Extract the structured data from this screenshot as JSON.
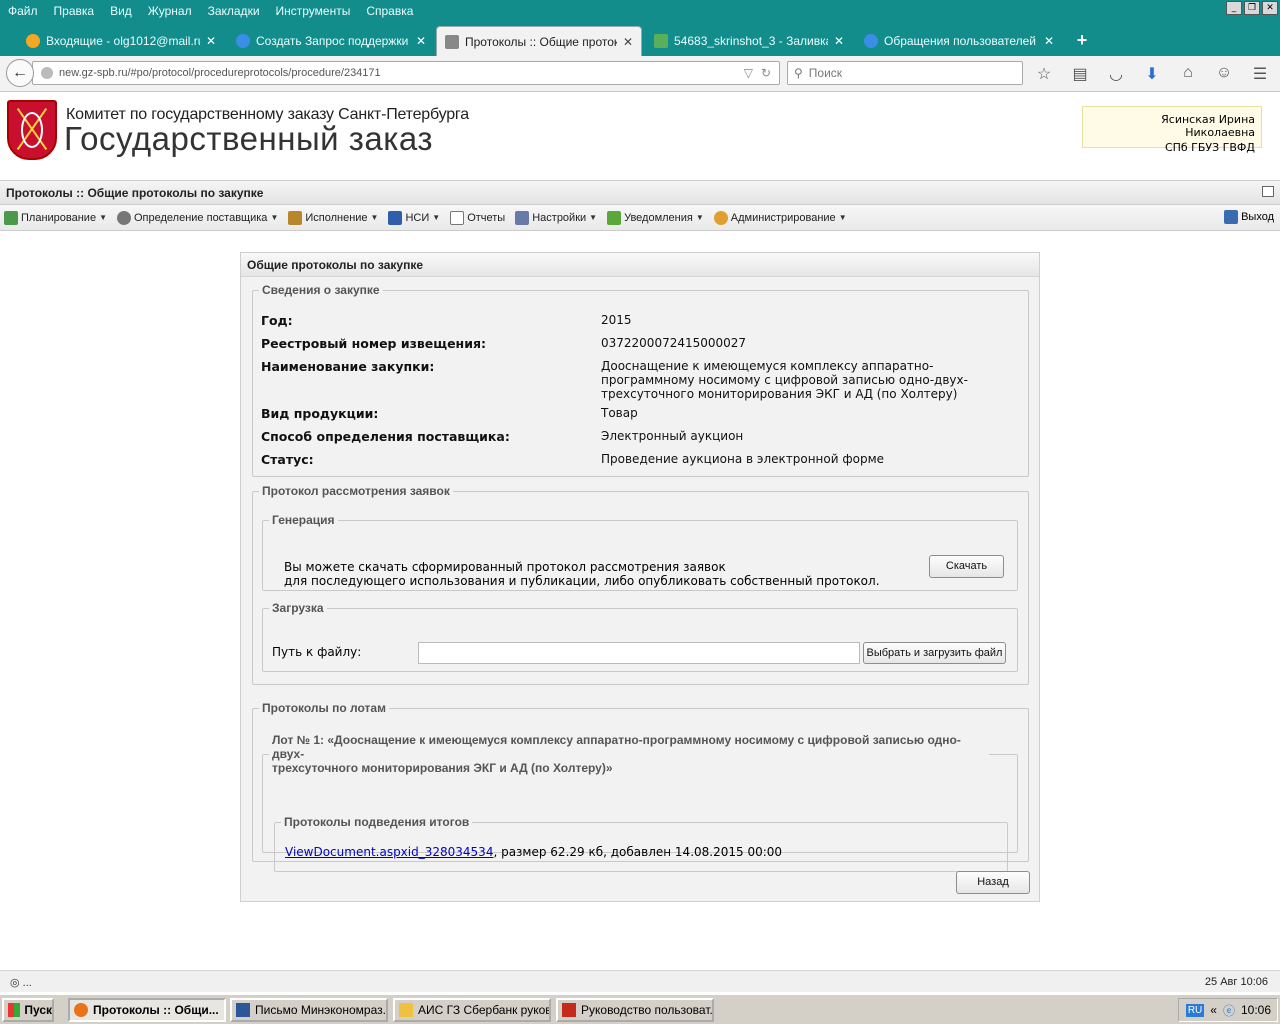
{
  "browser": {
    "menu": [
      "Файл",
      "Правка",
      "Вид",
      "Журнал",
      "Закладки",
      "Инструменты",
      "Справка"
    ],
    "tabs": [
      {
        "title": "Входящие - olg1012@mail.ru -..."
      },
      {
        "title": "Создать Запрос поддержки ..."
      },
      {
        "title": "Протоколы :: Общие проток..."
      },
      {
        "title": "54683_skrinshot_3 - Заливка ..."
      },
      {
        "title": "Обращения пользователей ..."
      }
    ],
    "url": "new.gz-spb.ru/#po/protocol/procedureprotocols/procedure/234171",
    "search_placeholder": "Поиск"
  },
  "header": {
    "org": "Комитет по государственному заказу Санкт-Петербурга",
    "title": "Государственный заказ",
    "user_name": "Ясинская Ирина Николаевна",
    "user_org": "СПб ГБУЗ ГВФД"
  },
  "page_title": "Протоколы :: Общие протоколы по закупке",
  "toolbar": {
    "items": [
      "Планирование",
      "Определение поставщика",
      "Исполнение",
      "НСИ",
      "Отчеты",
      "Настройки",
      "Уведомления",
      "Администрирование"
    ],
    "exit": "Выход"
  },
  "panel": {
    "title": "Общие протоколы по закупке",
    "info": {
      "legend": "Сведения о закупке",
      "rows": [
        {
          "label": "Год:",
          "value": "2015"
        },
        {
          "label": "Реестровый номер извещения:",
          "value": "0372200072415000027"
        },
        {
          "label": "Наименование закупки:",
          "value": "Дооснащение к имеющемуся комплексу аппаратно-программному носимому с цифровой записью одно-двух-трехсуточного мониторирования ЭКГ и АД (по Холтеру)"
        },
        {
          "label": "Вид продукции:",
          "value": "Товар"
        },
        {
          "label": "Способ определения поставщика:",
          "value": "Электронный аукцион"
        },
        {
          "label": "Статус:",
          "value": "Проведение аукциона в электронной форме"
        }
      ]
    },
    "review": {
      "legend": "Протокол рассмотрения заявок",
      "generation": {
        "legend": "Генерация",
        "text1": "Вы можете скачать сформированный протокол рассмотрения заявок",
        "text2": "для последующего использования и публикации, либо опубликовать собственный протокол.",
        "download": "Скачать"
      },
      "upload": {
        "legend": "Загрузка",
        "label": "Путь к файлу:",
        "value": "",
        "button": "Выбрать и загрузить файл"
      }
    },
    "lots": {
      "legend": "Протоколы по лотам",
      "lot_legend_1": "Лот № 1: «Дооснащение к имеющемуся комплексу аппаратно-программному носимому с цифровой записью одно-двух-",
      "lot_legend_2": "трехсуточного мониторирования ЭКГ и АД (по Холтеру)»",
      "results_legend": "Протоколы подведения итогов",
      "doc_link": "ViewDocument.aspxid_328034534",
      "doc_meta": ", размер 62.29 кб, добавлен 14.08.2015 00:00"
    },
    "back": "Назад"
  },
  "statusbar": {
    "left": "◎ ...",
    "right": "25 Авг 10:06"
  },
  "taskbar": {
    "start": "Пуск",
    "items": [
      "Протоколы :: Общи...",
      "Письмо Минэкономраз...",
      "АИС ГЗ Сбербанк руков...",
      "Руководство пользоват..."
    ],
    "lang": "RU",
    "time": "10:06"
  }
}
